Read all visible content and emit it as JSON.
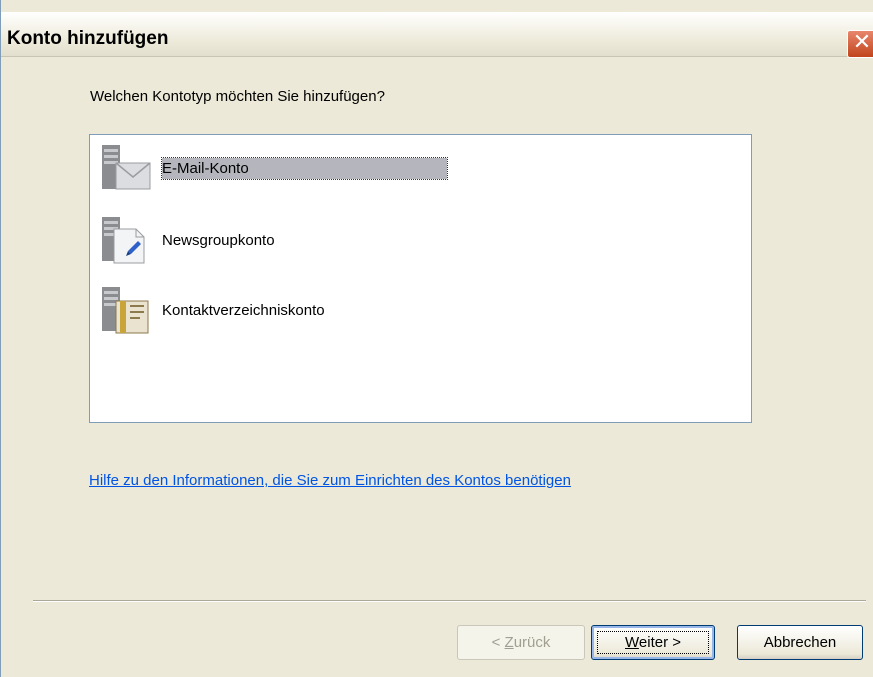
{
  "window": {
    "title": "Konto hinzufügen"
  },
  "prompt": "Welchen Kontotyp möchten Sie hinzufügen?",
  "account_types": [
    {
      "label": "E-Mail-Konto",
      "icon": "email-account-icon",
      "selected": true
    },
    {
      "label": "Newsgroupkonto",
      "icon": "newsgroup-account-icon",
      "selected": false
    },
    {
      "label": "Kontaktverzeichniskonto",
      "icon": "directory-account-icon",
      "selected": false
    }
  ],
  "help_link": "Hilfe zu den Informationen, die Sie zum Einrichten des Kontos benötigen",
  "buttons": {
    "back": {
      "prefix": "< ",
      "mnemonic": "Z",
      "rest": "urück"
    },
    "next": {
      "mnemonic": "W",
      "rest": "eiter >"
    },
    "cancel": "Abbrechen"
  },
  "colors": {
    "window_bg": "#ece9d8",
    "link": "#0054e3",
    "selection": "#b5b6bd",
    "close_button": "#c1441c"
  }
}
